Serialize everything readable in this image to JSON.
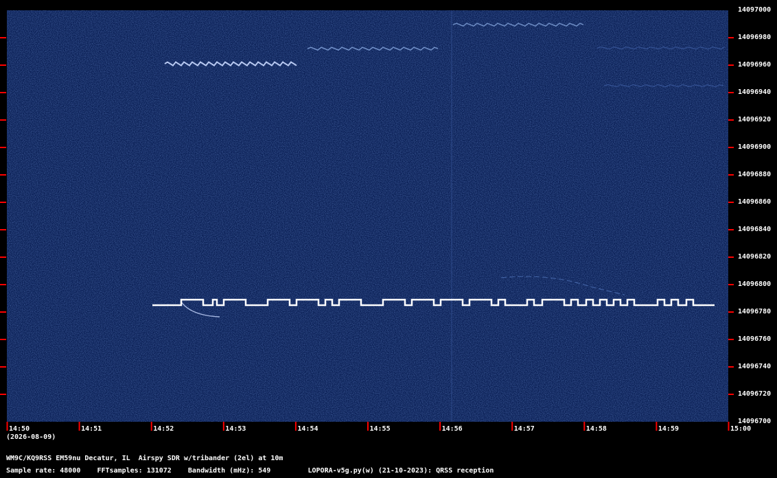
{
  "chart_data": {
    "type": "heatmap",
    "description_kind": "QRSS spectrogram (waterfall)",
    "y_ticks": [
      "14097000",
      "14096980",
      "14096960",
      "14096940",
      "14096920",
      "14096900",
      "14096880",
      "14096860",
      "14096840",
      "14096820",
      "14096800",
      "14096780",
      "14096760",
      "14096740",
      "14096720",
      "14096700"
    ],
    "x_ticks": [
      "14:50",
      "14:51",
      "14:52",
      "14:53",
      "14:54",
      "14:55",
      "14:56",
      "14:57",
      "14:58",
      "14:59",
      "15:00"
    ],
    "ylim": [
      14096700,
      14097000
    ],
    "xlim": [
      "14:50",
      "15:00"
    ],
    "date_label": "(2026-08-09)",
    "grid": false,
    "colors": {
      "background": "#000000",
      "waterfall": "#0a1f55",
      "signal": "#ffffff",
      "tick": "#ff0000"
    }
  },
  "footer": {
    "station": "WM9C/KQ9RSS EM59nu Decatur, IL  Airspy SDR w/tribander (2el) at 10m",
    "details": "Sample rate: 48000    FFTsamples: 131072    Bandwidth (mHz): 549         LOPORA-v5g.py(w) (21-10-2023): QRSS reception"
  }
}
